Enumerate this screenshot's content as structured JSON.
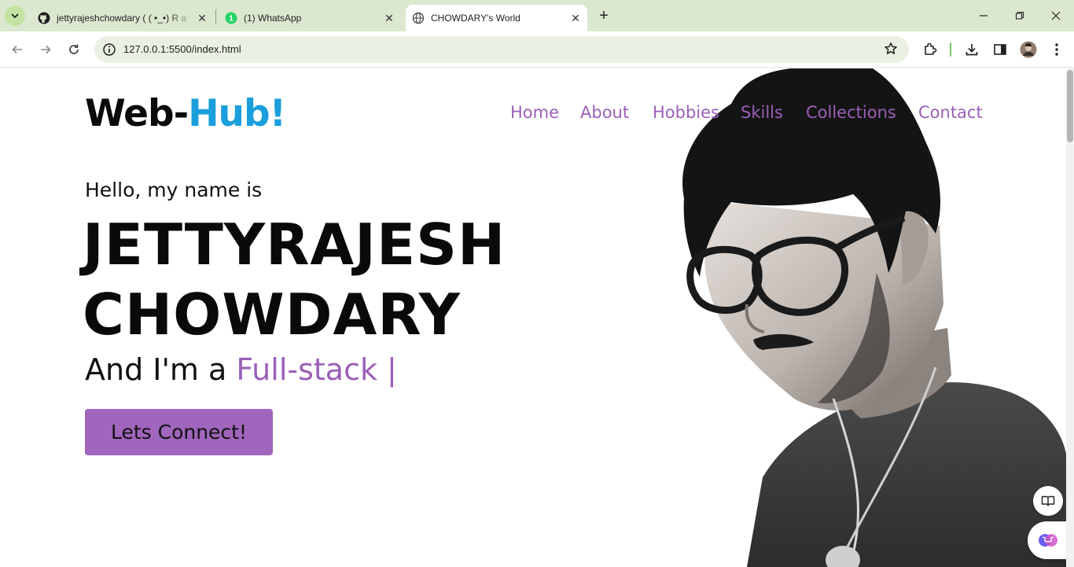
{
  "browser": {
    "tabs": [
      {
        "title": "jettyrajeshchowdary ( ( •_•) R a",
        "favicon": "github-icon"
      },
      {
        "title": "(1) WhatsApp",
        "favicon": "whatsapp-icon"
      },
      {
        "title": "CHOWDARY's World",
        "favicon": "globe-icon"
      }
    ],
    "url": "127.0.0.1:5500/index.html"
  },
  "page": {
    "logo": {
      "main": "Web-",
      "accent": "Hub!"
    },
    "nav": [
      "Home",
      "About",
      "Hobbies",
      "Skills",
      "Collections",
      "Contact"
    ],
    "greeting": "Hello, my name is",
    "name_line1": "JETTYRAJESH",
    "name_line2": "CHOWDARY",
    "role_prefix": "And I'm a ",
    "role_typed": "Full-stack |",
    "cta_label": "Lets Connect!"
  },
  "colors": {
    "accent_purple": "#9b5fb8",
    "logo_blue": "#1a9fdc",
    "button_purple": "#a065bc",
    "tab_strip": "#dbe8cf"
  },
  "icons": {
    "floating_top": "reader-mode-icon",
    "floating_bottom": "brain-assistant-icon",
    "portrait": "person-portrait"
  }
}
